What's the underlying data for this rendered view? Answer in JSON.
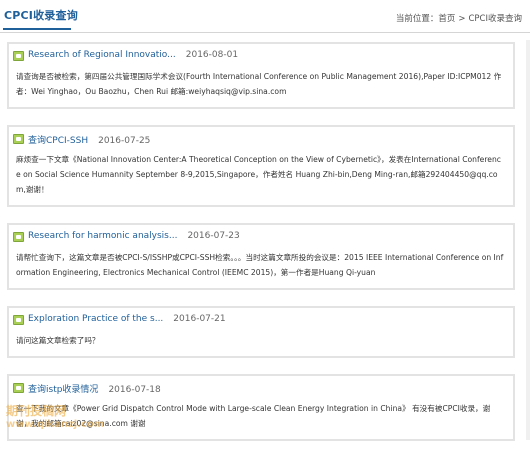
{
  "header": {
    "title": "CPCI收录查询",
    "breadcrumb_prefix": "当前位置：",
    "breadcrumb_home": "首页",
    "breadcrumb_sep": ">",
    "breadcrumb_current": "CPCI收录查询"
  },
  "items": [
    {
      "title": "Research of Regional Innovatio...",
      "date": "2016-08-01",
      "body": "请查询是否被检索，第四届公共管理国际学术会议(Fourth International Conference on Public Management 2016),Paper ID:ICPM012 作者：Wei Yinghao，Ou Baozhu，Chen Rui 邮箱:weiyhaqsiq@vip.sina.com"
    },
    {
      "title": "查询CPCI-SSH",
      "date": "2016-07-25",
      "body": "麻烦查一下文章《National Innovation Center:A Theoretical Conception on the View of Cybernetic》，发表在International Conference on Social Science Humannity September 8-9,2015,Singapore，作者姓名 Huang Zhi-bin,Deng Ming-ran,邮箱292404450@qq.com,谢谢！"
    },
    {
      "title": "Research for harmonic analysis...",
      "date": "2016-07-23",
      "body": "请帮忙查询下，这篇文章是否被CPCI-S/ISSHP或CPCI-SSH检索。。。当时这篇文章所投的会议是：2015 IEEE International Conference on Information Engineering, Electronics Mechanical Control (IEEMC 2015)，第一作者是Huang Qi-yuan"
    },
    {
      "title": "Exploration Practice of the s...",
      "date": "2016-07-21",
      "body": "请问这篇文章检索了吗？"
    },
    {
      "title": "查询istp收录情况",
      "date": "2016-07-18",
      "body": "查一下我的文章《Power Grid Dispatch Control Mode with Large-scale Clean Energy Integration in China》 有没有被CPCI收录，谢谢，我的邮箱caiz02@sina.com 谢谢"
    }
  ],
  "watermark": {
    "text": "期刊投稿网",
    "url": "www.qikanzj.com"
  }
}
